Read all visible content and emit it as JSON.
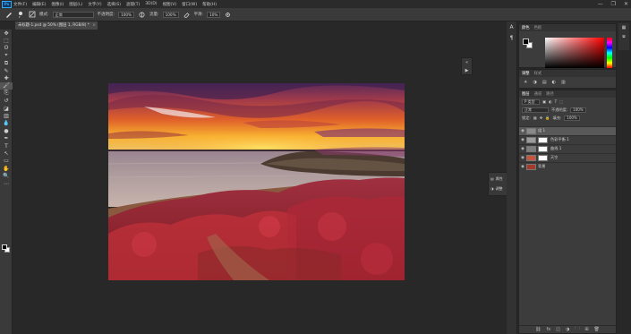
{
  "app": {
    "logo": "Ps"
  },
  "menu": [
    "文件(F)",
    "编辑(E)",
    "图像(I)",
    "图层(L)",
    "文字(Y)",
    "选择(S)",
    "滤镜(T)",
    "3D(D)",
    "视图(V)",
    "窗口(W)",
    "帮助(H)"
  ],
  "window_controls": [
    "—",
    "❐",
    "✕"
  ],
  "options": {
    "mode_label": "模式:",
    "mode_value": "正常",
    "opacity_label": "不透明度:",
    "opacity_value": "100%",
    "flow_label": "流量:",
    "flow_value": "100%",
    "smoothing_label": "平滑:",
    "smoothing_value": "10%"
  },
  "document_tab": {
    "title": "未标题-1.psd @ 50% (图层 1, RGB/8) *",
    "close": "×"
  },
  "tools": [
    "✥",
    "⬚",
    "ʘ",
    "⌖",
    "⧉",
    "✎",
    "✚",
    "🖌",
    "⎘",
    "↺",
    "◪",
    "▥",
    "💧",
    "●",
    "✒",
    "T",
    "↖",
    "▭",
    "✋",
    "🔍",
    "⋯"
  ],
  "mini_dock2": {
    "history_label": "属性",
    "adjust_label": "调整"
  },
  "color_panel": {
    "tabs": [
      "颜色",
      "色板"
    ],
    "field_color": "#ff0000"
  },
  "adjust_panel": {
    "tabs": [
      "调整",
      "样式"
    ],
    "icons": [
      "☀",
      "◑",
      "▤",
      "◐",
      "▥"
    ]
  },
  "layers_panel": {
    "tabs": [
      "图层",
      "通道",
      "路径"
    ],
    "filter_label": "Ρ 类型",
    "blend_mode": "正常",
    "opacity_label": "不透明度:",
    "opacity_value": "100%",
    "lock_label": "锁定:",
    "fill_label": "填充:",
    "fill_value": "100%",
    "layers": [
      {
        "name": "组 1",
        "visible": true,
        "selected": true,
        "thumb_color": "#8a8a8a",
        "has_mask": false
      },
      {
        "name": "色彩平衡 1",
        "visible": true,
        "selected": false,
        "thumb_color": "#9c9c9c",
        "has_mask": true
      },
      {
        "name": "曲线 1",
        "visible": true,
        "selected": false,
        "thumb_color": "#7d7d7d",
        "has_mask": true
      },
      {
        "name": "天空",
        "visible": true,
        "selected": false,
        "thumb_color": "#c7543c",
        "has_mask": true
      },
      {
        "name": "背景",
        "visible": true,
        "selected": false,
        "thumb_color": "#a33a2a",
        "has_mask": false
      }
    ],
    "bottom_icons": [
      "⛓",
      "fx",
      "◫",
      "◑",
      "🗀",
      "⊞",
      "🗑"
    ]
  },
  "colors": {
    "accent": "#31a8ff",
    "panel_bg": "#3c3c3c",
    "workspace_bg": "#282828"
  }
}
